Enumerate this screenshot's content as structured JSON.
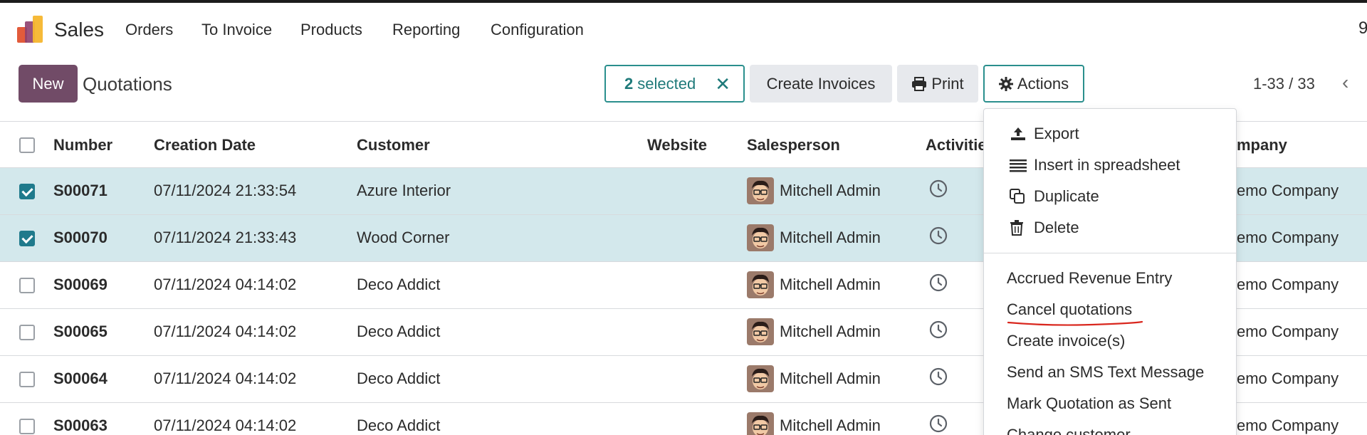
{
  "navbar": {
    "app_name": "Sales",
    "items": [
      "Orders",
      "To Invoice",
      "Products",
      "Reporting",
      "Configuration"
    ],
    "right_glyph": "9"
  },
  "control": {
    "new_label": "New",
    "title": "Quotations",
    "selected_count": "2",
    "selected_label": "selected",
    "clear_glyph": "✕",
    "create_invoices": "Create Invoices",
    "print": "Print",
    "actions": "Actions",
    "pager": "1-33 / 33",
    "pager_prev": "‹"
  },
  "table": {
    "headers": {
      "number": "Number",
      "creation_date": "Creation Date",
      "customer": "Customer",
      "website": "Website",
      "salesperson": "Salesperson",
      "activities": "Activitie",
      "company": "mpany"
    },
    "rows": [
      {
        "number": "S00071",
        "date": "07/11/2024 21:33:54",
        "customer": "Azure Interior",
        "salesperson": "Mitchell Admin",
        "company": "emo Company",
        "selected": true
      },
      {
        "number": "S00070",
        "date": "07/11/2024 21:33:43",
        "customer": "Wood Corner",
        "salesperson": "Mitchell Admin",
        "company": "emo Company",
        "selected": true
      },
      {
        "number": "S00069",
        "date": "07/11/2024 04:14:02",
        "customer": "Deco Addict",
        "salesperson": "Mitchell Admin",
        "company": "emo Company",
        "selected": false
      },
      {
        "number": "S00065",
        "date": "07/11/2024 04:14:02",
        "customer": "Deco Addict",
        "salesperson": "Mitchell Admin",
        "company": "emo Company",
        "selected": false
      },
      {
        "number": "S00064",
        "date": "07/11/2024 04:14:02",
        "customer": "Deco Addict",
        "salesperson": "Mitchell Admin",
        "company": "emo Company",
        "selected": false
      },
      {
        "number": "S00063",
        "date": "07/11/2024 04:14:02",
        "customer": "Deco Addict",
        "salesperson": "Mitchell Admin",
        "company": "emo Company",
        "selected": false
      }
    ]
  },
  "actions_menu": {
    "export": "Export",
    "insert": "Insert in spreadsheet",
    "duplicate": "Duplicate",
    "delete": "Delete",
    "accrued": "Accrued Revenue Entry",
    "cancel": "Cancel quotations",
    "create_invoice": "Create invoice(s)",
    "send_sms": "Send an SMS Text Message",
    "mark_sent": "Mark Quotation as Sent",
    "change_customer": "Change customer"
  },
  "colors": {
    "brand": "#714b67",
    "accent": "#2a8f8d",
    "selected_row": "#d3e8ec",
    "annotation": "#d9271e"
  }
}
